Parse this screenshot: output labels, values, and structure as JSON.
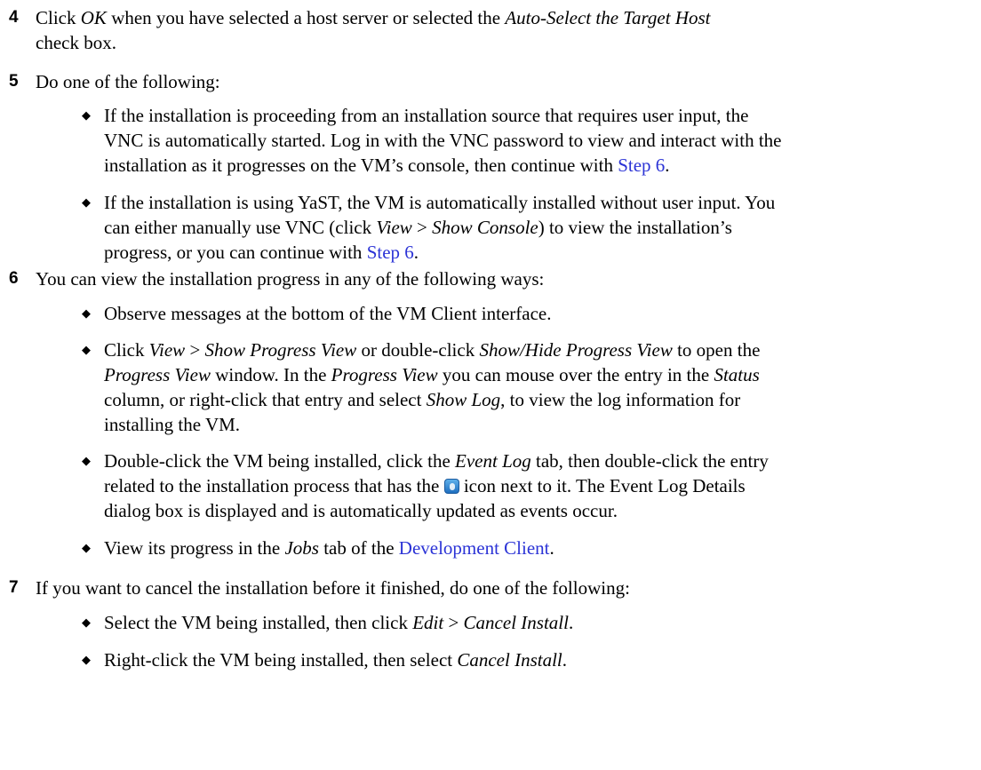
{
  "step4": {
    "num": "4",
    "t1": "Click ",
    "ok": "OK",
    "t2": " when you have selected a host server or selected the ",
    "auto": "Auto-Select the Target Host",
    "t3": "check box."
  },
  "step5": {
    "num": "5",
    "text": "Do one of the following:",
    "b1": {
      "l1": "If the installation is proceeding from an installation source that requires user input, the",
      "l2": "VNC is automatically started. Log in with the VNC password to view and interact with the",
      "l3": "installation as it progresses on the VM’s console, then continue with ",
      "link": "Step 6",
      "end": "."
    },
    "b2": {
      "l1": "If the installation is using YaST, the VM is automatically installed without user input. You",
      "l2a": "can either manually use VNC (click ",
      "view": "View",
      "gt": " > ",
      "show_console": "Show Console",
      "l2b": ") to view the installation’s",
      "l3": "progress, or you can continue with ",
      "link": "Step 6",
      "end": "."
    }
  },
  "step6": {
    "num": "6",
    "text": "You can view the installation progress in any of the following ways:",
    "b1": "Observe messages at the bottom of the VM Client interface.",
    "b2": {
      "a": "Click ",
      "view": "View",
      "gt": " > ",
      "spv": "Show Progress View",
      "b": " or double-click ",
      "shpv": "Show/Hide Progress View",
      "c": " to open the",
      "pv1": "Progress View",
      "d": " window. In the ",
      "pv2": "Progress View",
      "e": " you can mouse over the entry in the ",
      "status": "Status",
      "f": "column, or right-click that entry and select ",
      "showlog": "Show Log",
      "g": ", to view the log information for",
      "h": "installing the VM."
    },
    "b3": {
      "a": "Double-click the VM being installed, click the ",
      "eventlog": "Event Log",
      "b": " tab, then double-click the entry",
      "c": "related to the installation process that has the ",
      "d": " icon next to it. The Event Log Details",
      "e": "dialog box is displayed and is automatically updated as events occur."
    },
    "b4": {
      "a": "View its progress in the ",
      "jobs": "Jobs",
      "b": " tab of the ",
      "link": "Development Client",
      "end": "."
    }
  },
  "step7": {
    "num": "7",
    "text": "If you want to cancel the installation before it finished, do one of the following:",
    "b1": {
      "a": "Select the VM being installed, then click ",
      "edit": "Edit",
      "gt": " > ",
      "cancel": "Cancel Install",
      "end": "."
    },
    "b2": {
      "a": "Right-click the VM being installed, then select ",
      "cancel": "Cancel Install",
      "end": "."
    }
  },
  "bullet_glyph": "◆",
  "icon": "info-icon"
}
